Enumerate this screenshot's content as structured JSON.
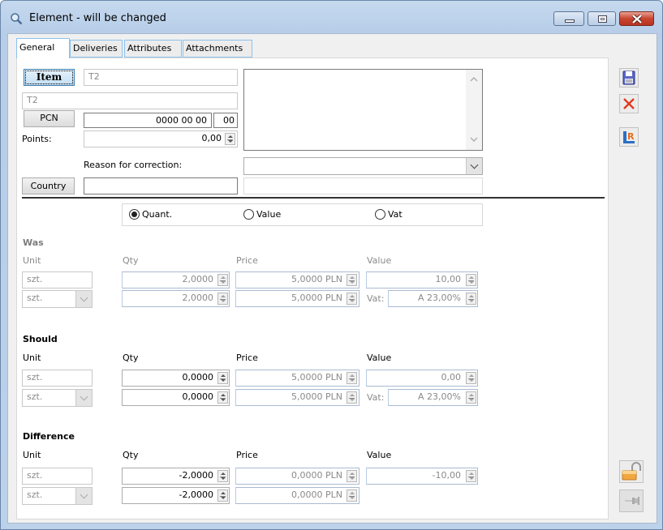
{
  "window": {
    "title": "Element - will be changed",
    "controls": [
      "minimize",
      "maximize",
      "close"
    ]
  },
  "tabs": [
    {
      "label": "General",
      "active": true
    },
    {
      "label": "Deliveries",
      "active": false
    },
    {
      "label": "Attributes",
      "active": false
    },
    {
      "label": "Attachments",
      "active": false
    }
  ],
  "header": {
    "item_button": "Item",
    "item_code": "T2",
    "item_name": "T2",
    "pcn_button": "PCN",
    "pcn_code": "0000 00 00",
    "pcn_suffix": "00",
    "points_label": "Points:",
    "points_value": "0,00",
    "description": "",
    "reason_label": "Reason for correction:",
    "reason_value": "",
    "reason_extra": "",
    "country_button": "Country",
    "country_value": ""
  },
  "mode": {
    "options": [
      {
        "label": "Quant.",
        "selected": true
      },
      {
        "label": "Value",
        "selected": false
      },
      {
        "label": "Vat",
        "selected": false
      }
    ]
  },
  "columns": {
    "unit": "Unit",
    "qty": "Qty",
    "price": "Price",
    "value": "Value",
    "vat": "Vat:"
  },
  "sections": {
    "was": {
      "title": "Was",
      "unit1": "szt.",
      "unit2": "szt.",
      "qty1": "2,0000",
      "qty2": "2,0000",
      "price1": "5,0000 PLN",
      "price2": "5,0000 PLN",
      "value": "10,00",
      "vat": "A 23,00%"
    },
    "should": {
      "title": "Should",
      "unit1": "szt.",
      "unit2": "szt.",
      "qty1": "0,0000",
      "qty2": "0,0000",
      "price1": "5,0000 PLN",
      "price2": "5,0000 PLN",
      "value": "0,00",
      "vat": "A 23,00%"
    },
    "difference": {
      "title": "Difference",
      "unit1": "szt.",
      "unit2": "szt.",
      "qty1": "-2,0000",
      "qty2": "-2,0000",
      "price1": "0,0000 PLN",
      "price2": "0,0000 PLN",
      "value": "-10,00"
    }
  },
  "sidebar": {
    "actions": [
      "save-icon",
      "cancel-icon",
      "report-icon"
    ],
    "bottom": [
      "unlock-icon",
      "pin-icon"
    ]
  }
}
